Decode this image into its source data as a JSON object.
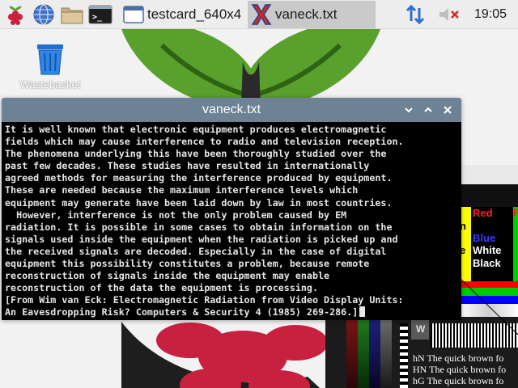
{
  "taskbar": {
    "launchers": [
      {
        "icon": "raspberry-menu-icon"
      },
      {
        "icon": "web-browser-globe-icon"
      },
      {
        "icon": "file-manager-folder-icon"
      },
      {
        "icon": "terminal-icon",
        "text": ">_"
      }
    ],
    "tasks": [
      {
        "label": "testcard_640x4",
        "icon": "image-viewer-icon",
        "active": false
      },
      {
        "label": "vaneck.txt",
        "icon": "text-editor-x-icon",
        "active": true
      }
    ],
    "tray": {
      "network_icon": "network-arrows-icon",
      "volume_icon": "volume-muted-icon",
      "clock": "19:05"
    }
  },
  "desktop": {
    "icons": [
      {
        "label": "Wastebasket",
        "icon": "trash-bin-icon"
      }
    ],
    "colors": {
      "leaf": "#5aa02c",
      "berry": "#c8203f",
      "background": "#f2f2f2"
    }
  },
  "testcard": {
    "labels": {
      "red": "Red",
      "blue": "Blue",
      "white": "White",
      "black": "Black",
      "n": "n",
      "e": "e",
      "w": "W",
      "f": "F"
    },
    "sample_lines": [
      "hN The quick brown fo",
      "HN The quick brown fo",
      "hG The quick brown fo"
    ],
    "colors": {
      "red": "#ff0000",
      "green": "#00cc00",
      "blue": "#0000ff",
      "yellow": "#ffff00",
      "magenta": "#ff00ff",
      "cyan": "#00ffff"
    }
  },
  "editor": {
    "title": "vaneck.txt",
    "titlebar_color": "#6d8294",
    "buttons": [
      {
        "icon": "minimize-chevron-icon"
      },
      {
        "icon": "maximize-chevron-icon"
      },
      {
        "icon": "close-x-icon"
      }
    ],
    "lines": [
      "It is well known that electronic equipment produces electromagnetic",
      "fields which may cause interference to radio and television reception.",
      "The phenomena underlying this have been thoroughly studied over the",
      "past few decades. These studies have resulted in internationally",
      "agreed methods for measuring the interference produced by equipment.",
      "These are needed because the maximum interference levels which",
      "equipment may generate have been laid down by law in most countries.",
      "  However, interference is not the only problem caused by EM",
      "radiation. It is possible in some cases to obtain information on the",
      "signals used inside the equipment when the radiation is picked up and",
      "the received signals are decoded. Especially in the case of digital",
      "equipment this possibility constitutes a problem, because remote",
      "reconstruction of signals inside the equipment may enable",
      "reconstruction of the data the equipment is processing.",
      "[From Wim van Eck: Electromagnetic Radiation from Video Display Units:",
      "An Eavesdropping Risk? Computers & Security 4 (1985) 269-286.]"
    ]
  }
}
